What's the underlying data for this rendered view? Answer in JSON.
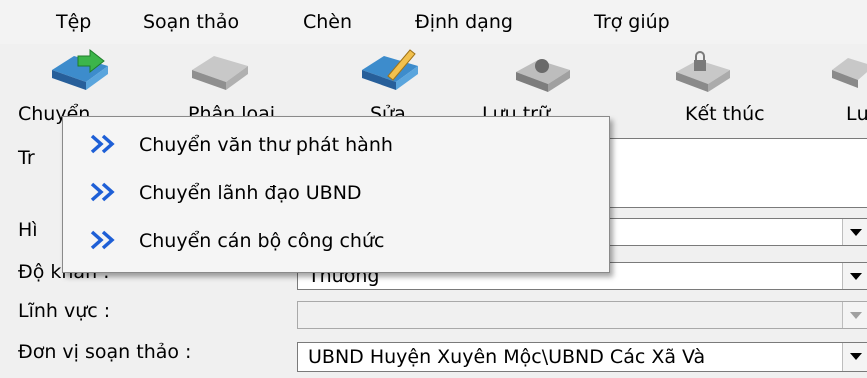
{
  "menubar": {
    "items": [
      "Tệp",
      "Soạn thảo",
      "Chèn",
      "Định dạng",
      "Trợ giúp"
    ]
  },
  "toolbar": {
    "buttons": [
      {
        "label": "Chuyển",
        "icon": "folder-forward-icon"
      },
      {
        "label": "Phân loại",
        "icon": "folder-icon"
      },
      {
        "label": "Sửa",
        "icon": "edit-document-icon"
      },
      {
        "label": "Lưu trữ",
        "icon": "archive-icon"
      },
      {
        "label": "Kết thúc",
        "icon": "lock-folder-icon"
      },
      {
        "label": "Lưu",
        "icon": "save-icon"
      }
    ]
  },
  "form": {
    "trich_yeu_label": "Tr",
    "hinh_thuc_label": "Hì",
    "do_khan_label": "Độ khẩn :",
    "do_khan_value": "Thường",
    "linh_vuc_label": "Lĩnh vực :",
    "linh_vuc_value": "",
    "don_vi_label": "Đơn vị soạn thảo :",
    "don_vi_value": "UBND Huyện Xuyên Mộc\\UBND Các Xã Và"
  },
  "popup_menu": {
    "items": [
      "Chuyển văn thư phát hành",
      "Chuyển lãnh đạo UBND",
      "Chuyển cán bộ công chức"
    ]
  },
  "colors": {
    "chevron": "#1e5fd6",
    "window_bg": "#f0f0f0"
  }
}
